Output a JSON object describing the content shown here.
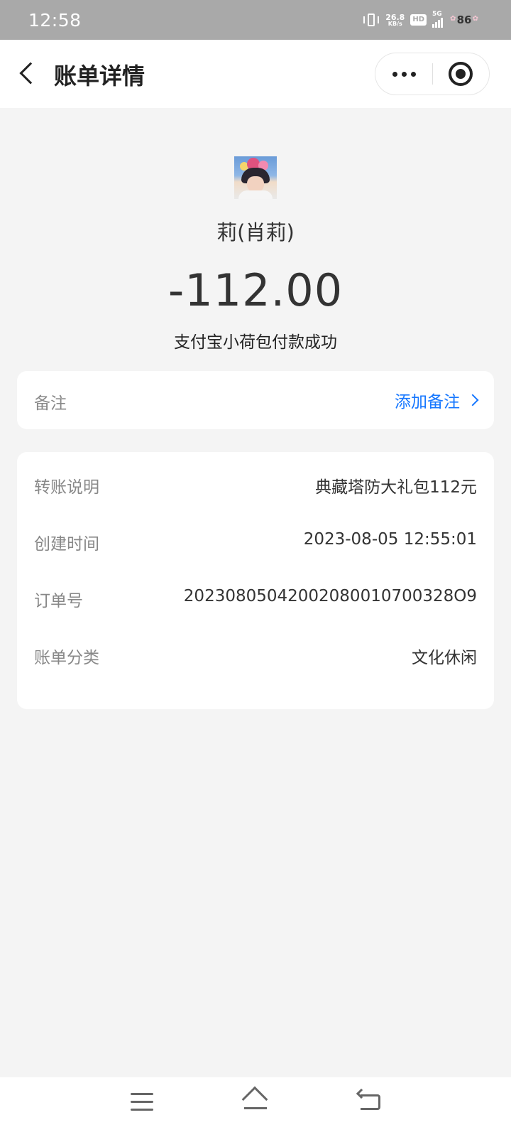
{
  "status_bar": {
    "time": "12:58",
    "net_speed_value": "26.8",
    "net_speed_unit": "KB/s",
    "hd_label": "HD",
    "network_label": "5G",
    "battery_level": "86"
  },
  "nav": {
    "title": "账单详情"
  },
  "payee": {
    "name": "莉(肖莉)",
    "amount": "-112.00",
    "status": "支付宝小荷包付款成功"
  },
  "remark": {
    "label": "备注",
    "action_label": "添加备注"
  },
  "details": [
    {
      "label": "转账说明",
      "value": "典藏塔防大礼包112元"
    },
    {
      "label": "创建时间",
      "value": "2023-08-05 12:55:01"
    },
    {
      "label": "订单号",
      "value": "20230805042002080010700328O9"
    },
    {
      "label": "账单分类",
      "value": "文化休闲"
    }
  ],
  "colors": {
    "accent": "#1677ff",
    "page_background": "#f4f4f4",
    "status_bar": "#a9a9a9"
  },
  "icons": {
    "back": "chevron-left-icon",
    "more": "more-dots-icon",
    "close": "target-close-icon",
    "remark_chevron": "chevron-right-icon",
    "sys_menu": "menu-icon",
    "sys_home": "home-icon",
    "sys_back": "back-arrow-icon"
  }
}
